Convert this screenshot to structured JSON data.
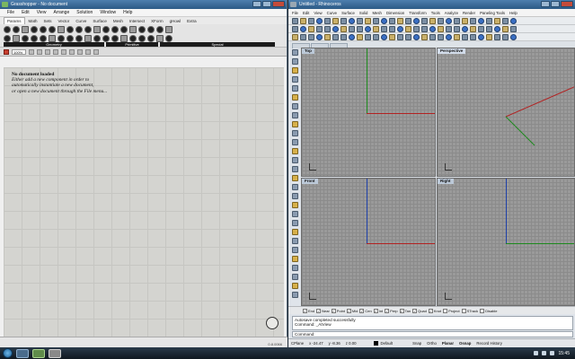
{
  "grasshopper": {
    "title": "Grasshopper - No document",
    "menu": [
      "File",
      "Edit",
      "View",
      "Arrange",
      "Solution",
      "Window",
      "Help"
    ],
    "component_tabs": [
      "Params",
      "Math",
      "Sets",
      "Vector",
      "Curve",
      "Surface",
      "Mesh",
      "Intersect",
      "XForm",
      "gHowl",
      "Extra"
    ],
    "active_tab": "Params",
    "groups": [
      "Geometry",
      "Primitive",
      "Special"
    ],
    "zoom": "100%",
    "message": {
      "title": "No document loaded",
      "lines": [
        "Either add a new component in order to",
        "automatically instantiate a new document,",
        "or open a new document through the File menu..."
      ]
    },
    "version": "0.8.0066"
  },
  "rhino": {
    "title": "Untitled - Rhinoceros",
    "menu": [
      "File",
      "Edit",
      "View",
      "Curve",
      "Surface",
      "Solid",
      "Mesh",
      "Dimension",
      "Transform",
      "Tools",
      "Analyze",
      "Render",
      "Paneling Tools",
      "Help"
    ],
    "viewports": [
      "Top",
      "Perspective",
      "Front",
      "Right"
    ],
    "active_viewport": "Perspective",
    "osnaps": [
      {
        "label": "End",
        "checked": true
      },
      {
        "label": "Near",
        "checked": true
      },
      {
        "label": "Point",
        "checked": true
      },
      {
        "label": "Mid",
        "checked": true
      },
      {
        "label": "Cen",
        "checked": true
      },
      {
        "label": "Int",
        "checked": true
      },
      {
        "label": "Perp",
        "checked": true
      },
      {
        "label": "Tan",
        "checked": true
      },
      {
        "label": "Quad",
        "checked": true
      },
      {
        "label": "Knot",
        "checked": true
      },
      {
        "label": "Project",
        "checked": false
      },
      {
        "label": "STrack",
        "checked": false
      },
      {
        "label": "Disable",
        "checked": false
      }
    ],
    "command_history": [
      "Autosave completed successfully",
      "Command: _AtView"
    ],
    "command_prompt": "Command:",
    "status": {
      "cplane": "CPlane",
      "x": "x -24.47",
      "y": "y -8.36",
      "z": "z 0.00",
      "layer": "Default",
      "toggles": [
        "Snap",
        "Ortho",
        "Planar",
        "Osnap",
        "Record History"
      ]
    }
  },
  "taskbar": {
    "clock": "15:45"
  }
}
